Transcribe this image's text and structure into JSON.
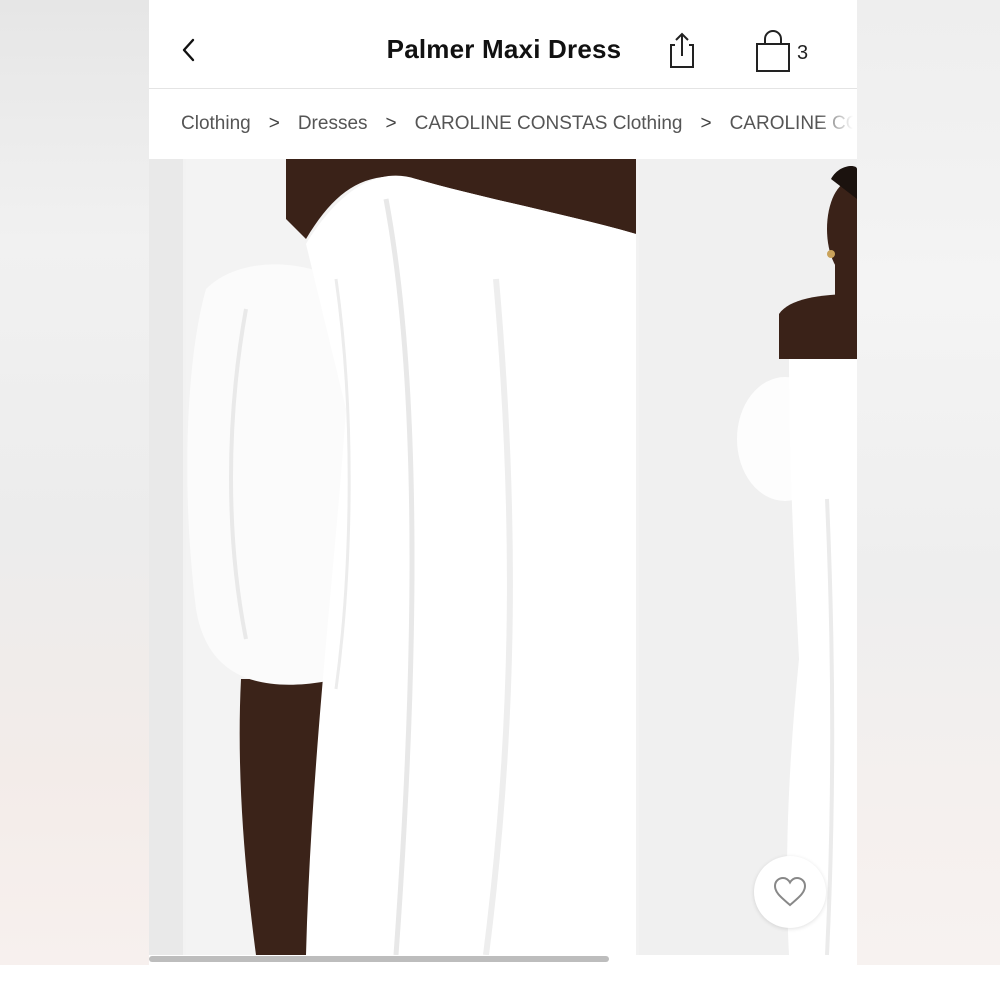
{
  "header": {
    "title": "Palmer Maxi Dress",
    "back_icon": "chevron-left-icon",
    "share_icon": "share-icon",
    "bag_icon": "shopping-bag-icon",
    "bag_count": "3"
  },
  "breadcrumb": {
    "items": [
      "Clothing",
      "Dresses",
      "CAROLINE CONSTAS Clothing",
      "CAROLINE CONSTAS"
    ],
    "separator": ">"
  },
  "gallery": {
    "images": [
      "dress-detail-photo",
      "dress-full-length-photo"
    ],
    "favorite_icon": "heart-icon",
    "scroll_fraction": 0.65
  },
  "colors": {
    "text": "#111111",
    "breadcrumb_text": "#555555",
    "dress": "#ffffff",
    "skin": "#3a2218"
  }
}
